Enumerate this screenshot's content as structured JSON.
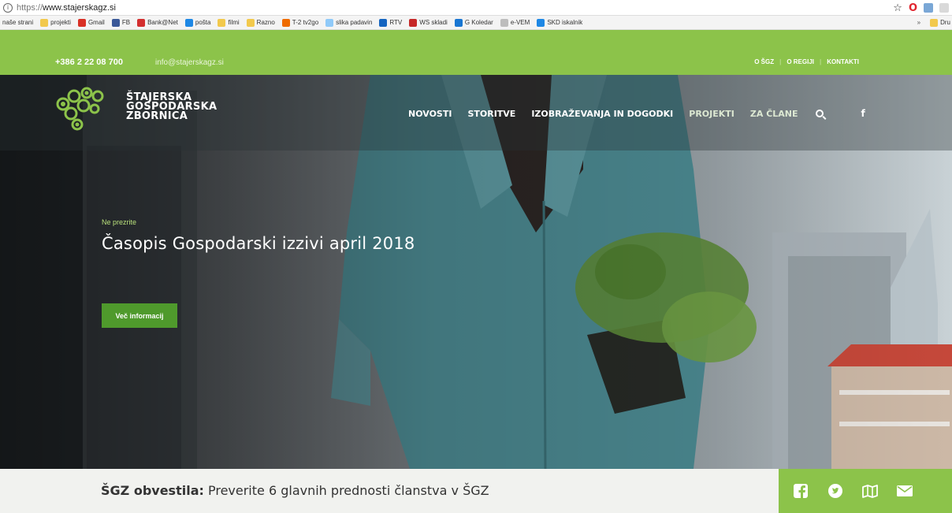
{
  "browser": {
    "url_protocol": "https://",
    "url_host": "www.stajerskagz.si",
    "bookmarks": [
      {
        "label": "naše strani",
        "color": ""
      },
      {
        "label": "projekti",
        "color": "#f2c94c"
      },
      {
        "label": "Gmail",
        "color": "#d93025"
      },
      {
        "label": "FB",
        "color": "#3b5998"
      },
      {
        "label": "Bank@Net",
        "color": "#d32f2f"
      },
      {
        "label": "pošta",
        "color": "#1e88e5"
      },
      {
        "label": "filmi",
        "color": "#f2c94c"
      },
      {
        "label": "Razno",
        "color": "#f2c94c"
      },
      {
        "label": "T-2 tv2go",
        "color": "#ef6c00"
      },
      {
        "label": "slika padavin",
        "color": "#90caf9"
      },
      {
        "label": "RTV",
        "color": "#1565c0"
      },
      {
        "label": "WS skladi",
        "color": "#c62828"
      },
      {
        "label": "G Koledar",
        "color": "#1976d2"
      },
      {
        "label": "e-VEM",
        "color": "#bdbdbd"
      },
      {
        "label": "SKD iskalnik",
        "color": "#1e88e5"
      }
    ],
    "bookmarks_more": "»",
    "bookmarks_last": "Dru"
  },
  "topbar": {
    "phone": "+386 2 22 08 700",
    "email": "info@stajerskagz.si",
    "links": [
      "O ŠGZ",
      "O REGIJI",
      "KONTAKTI"
    ]
  },
  "logo": {
    "line1": "ŠTAJERSKA",
    "line2": "GOSPODARSKA",
    "line3": "ZBORNICA"
  },
  "nav": {
    "items": [
      "NOVOSTI",
      "STORITVE",
      "IZOBRAŽEVANJA IN DOGODKI",
      "PROJEKTI",
      "ZA ČLANE"
    ],
    "search_icon": "search-icon",
    "facebook_icon": "facebook-icon"
  },
  "hero": {
    "eyebrow": "Ne prezrite",
    "headline": "Časopis Gospodarski izzivi april 2018",
    "cta": "Več informacij"
  },
  "notice": {
    "label": "ŠGZ obvestila:",
    "text": " Preverite 6 glavnih prednosti članstva v ŠGZ"
  },
  "social": [
    "facebook-icon",
    "twitter-icon",
    "map-icon",
    "mail-icon"
  ],
  "colors": {
    "brand_green": "#8cc34a",
    "button_green": "#4f9a2c",
    "eyebrow_green": "#b9e07b"
  }
}
